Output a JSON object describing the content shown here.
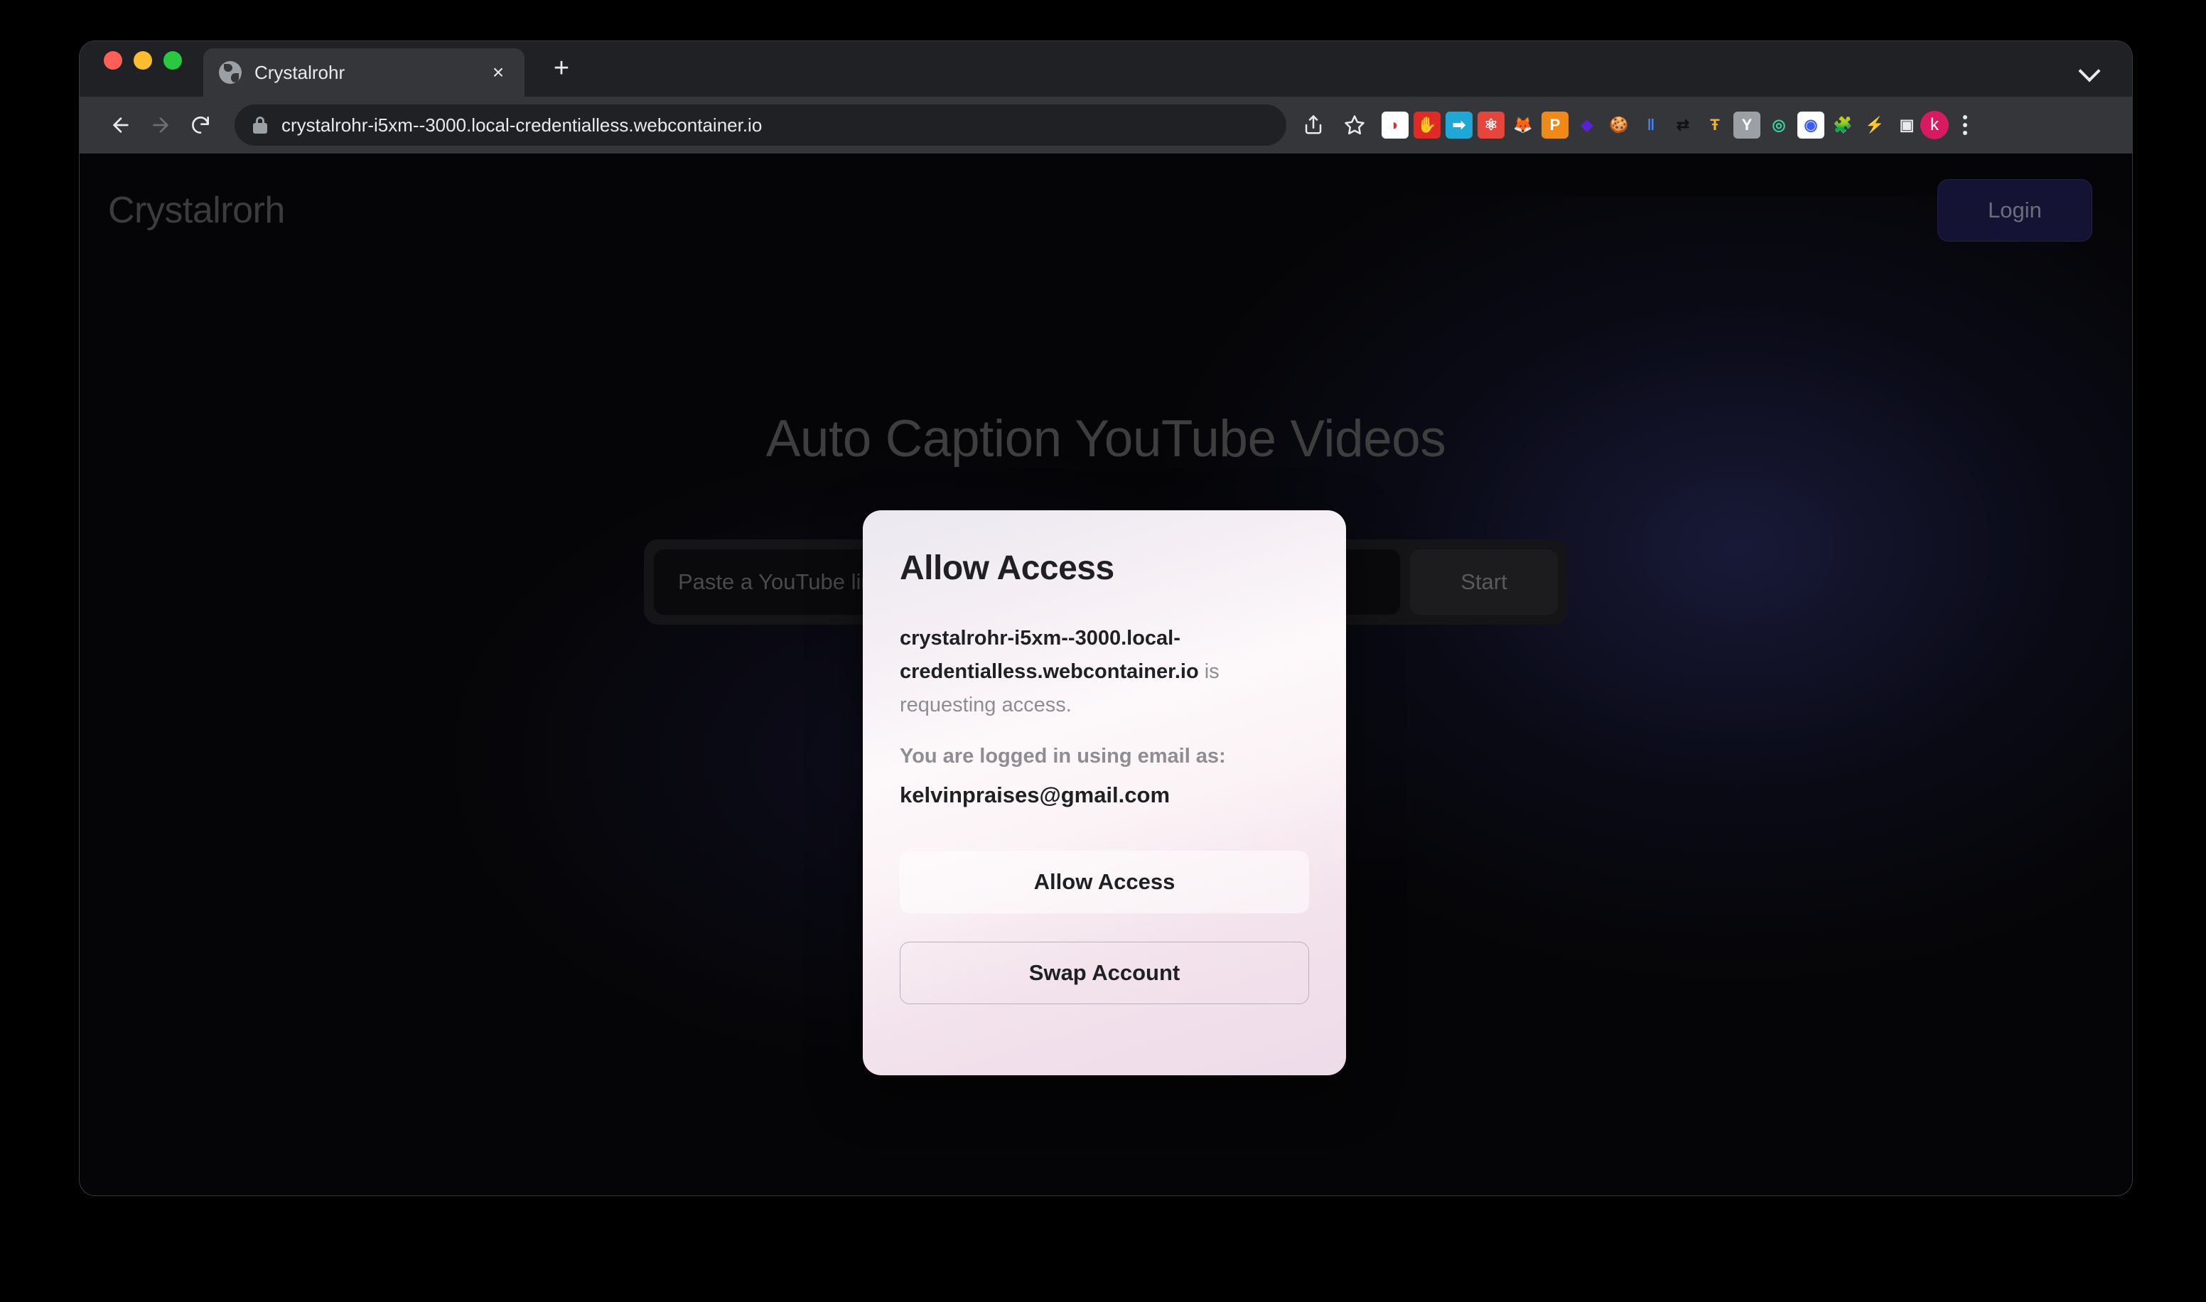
{
  "browser": {
    "tab": {
      "title": "Crystalrohr",
      "favicon": "globe-icon",
      "close_label": "×"
    },
    "new_tab_label": "+",
    "tabstrip_chevron": "chevron-down-icon",
    "nav": {
      "back": "back-arrow-icon",
      "forward": "forward-arrow-icon",
      "reload": "reload-icon"
    },
    "omnibox": {
      "lock": "lock-icon",
      "url": "crystalrohr-i5xm--3000.local-credentialless.webcontainer.io"
    },
    "actions": {
      "share": "share-icon",
      "bookmark": "star-icon"
    },
    "extensions": [
      {
        "name": "shield-extension-icon",
        "glyph": "◗",
        "bg": "#ffffff",
        "fg": "#d7322b"
      },
      {
        "name": "adblock-hand-extension-icon",
        "glyph": "✋",
        "bg": "#e02a25",
        "fg": "#ffffff"
      },
      {
        "name": "import-document-extension-icon",
        "glyph": "➡",
        "bg": "#1fa8d6",
        "fg": "#ffffff"
      },
      {
        "name": "react-devtools-extension-icon",
        "glyph": "⚛",
        "bg": "#e6453c",
        "fg": "#ffffff"
      },
      {
        "name": "metamask-fox-extension-icon",
        "glyph": "🦊",
        "bg": "transparent",
        "fg": "#b57ae0"
      },
      {
        "name": "phantom-wallet-extension-icon",
        "glyph": "P",
        "bg": "#f08a17",
        "fg": "#ffffff"
      },
      {
        "name": "diamond-wallet-extension-icon",
        "glyph": "◆",
        "bg": "transparent",
        "fg": "#5b21d6"
      },
      {
        "name": "cookie-editor-extension-icon",
        "glyph": "🍪",
        "bg": "transparent",
        "fg": "#c68a52"
      },
      {
        "name": "pause-extension-icon",
        "glyph": "‖",
        "bg": "transparent",
        "fg": "#3b82f6"
      },
      {
        "name": "sync-swap-extension-icon",
        "glyph": "⇄",
        "bg": "transparent",
        "fg": "#111111"
      },
      {
        "name": "grammarly-extension-icon",
        "glyph": "Ŧ",
        "bg": "transparent",
        "fg": "#f0b429"
      },
      {
        "name": "yahoo-extension-icon",
        "glyph": "Y",
        "bg": "#9aa0a6",
        "fg": "#ffffff"
      },
      {
        "name": "circles-tracker-extension-icon",
        "glyph": "◎",
        "bg": "transparent",
        "fg": "#34d399"
      },
      {
        "name": "screen-recorder-extension-icon",
        "glyph": "◉",
        "bg": "#ffffff",
        "fg": "#3b5bf5"
      },
      {
        "name": "puzzle-extensions-icon",
        "glyph": "🧩",
        "bg": "transparent",
        "fg": "#e8eaed"
      },
      {
        "name": "leaf-energy-extension-icon",
        "glyph": "⚡",
        "bg": "transparent",
        "fg": "#e8eaed"
      },
      {
        "name": "sidebar-toggle-icon",
        "glyph": "▣",
        "bg": "transparent",
        "fg": "#e8eaed"
      }
    ],
    "profile_avatar": "k",
    "menu": "kebab-menu-icon"
  },
  "page": {
    "brand": "Crystalrorh",
    "login_button": "Login",
    "hero_title": "Auto Caption YouTube Videos",
    "input_placeholder": "Paste a YouTube link here",
    "start_button": "Start"
  },
  "modal": {
    "title": "Allow Access",
    "origin": "crystalrohr-i5xm--3000.local-credentialless.webcontainer.io",
    "request_suffix": " is requesting access.",
    "logged_in_label": "You are logged in using email as:",
    "email": "kelvinpraises@gmail.com",
    "allow_button": "Allow Access",
    "swap_button": "Swap Account"
  },
  "colors": {
    "accent_login_bg": "#141333",
    "avatar_bg": "#d81b60",
    "page_bg": "#050507",
    "modal_gradient_start": "#ebe8f0",
    "modal_gradient_end": "#eedbe9"
  }
}
